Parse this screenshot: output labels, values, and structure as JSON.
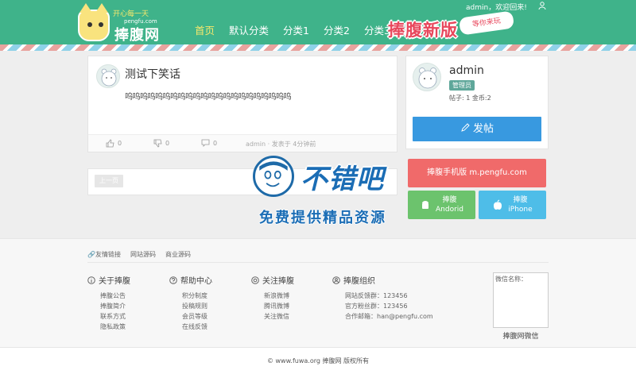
{
  "header": {
    "logo_name": "捧腹网",
    "logo_slogan": "开心每一天",
    "logo_domain": "pengfu.com",
    "nav": [
      "首页",
      "默认分类",
      "分类1",
      "分类2",
      "分类3"
    ],
    "active_nav": "首页",
    "banner_title": "捧腹新版",
    "banner_ribbon": "等你来玩",
    "welcome": "admin，欢迎回来!",
    "colors": {
      "header_bg": "#3fb38a",
      "nav_active": "#f7e86c"
    }
  },
  "post": {
    "title": "测试下笑话",
    "body": "呜呜呜呜呜呜呜呜呜呜呜呜呜呜呜呜呜呜呜呜呜呜",
    "likes": "0",
    "dislikes": "0",
    "comments": "0",
    "author": "admin",
    "time": "发表于 4分钟前"
  },
  "pager": {
    "prev": "上一页"
  },
  "profile": {
    "name": "admin",
    "role": "管理员",
    "stats": "帖子: 1    金币:2",
    "post_button": "发帖"
  },
  "apps": {
    "mobile": "捧腹手机版 m.pengfu.com",
    "android_line1": "捧腹",
    "android_line2": "Andorid",
    "iphone_line1": "捧腹",
    "iphone_line2": "iPhone"
  },
  "watermark": {
    "title": "不错吧",
    "subtitle": "免费提供精品资源"
  },
  "footer": {
    "links_label": "友情链接",
    "links": [
      "网站源码",
      "商业源码"
    ],
    "columns": [
      {
        "title": "关于捧腹",
        "items": [
          "捧腹公告",
          "捧腹简介",
          "联系方式",
          "隐私政策"
        ]
      },
      {
        "title": "帮助中心",
        "items": [
          "积分制度",
          "投稿规则",
          "会员等级",
          "在线反馈"
        ]
      },
      {
        "title": "关注捧腹",
        "items": [
          "新浪微博",
          "腾讯微博",
          "关注微信"
        ]
      },
      {
        "title": "捧腹组织",
        "items": [
          "网站反馈群：123456",
          "官方粉丝群：123456",
          "合作邮箱：han@pengfu.com"
        ]
      }
    ],
    "qr_label": "微信名称：",
    "qr_caption": "捧腹网微信",
    "copyright": "© www.fuwa.org 捧腹网 版权所有"
  }
}
